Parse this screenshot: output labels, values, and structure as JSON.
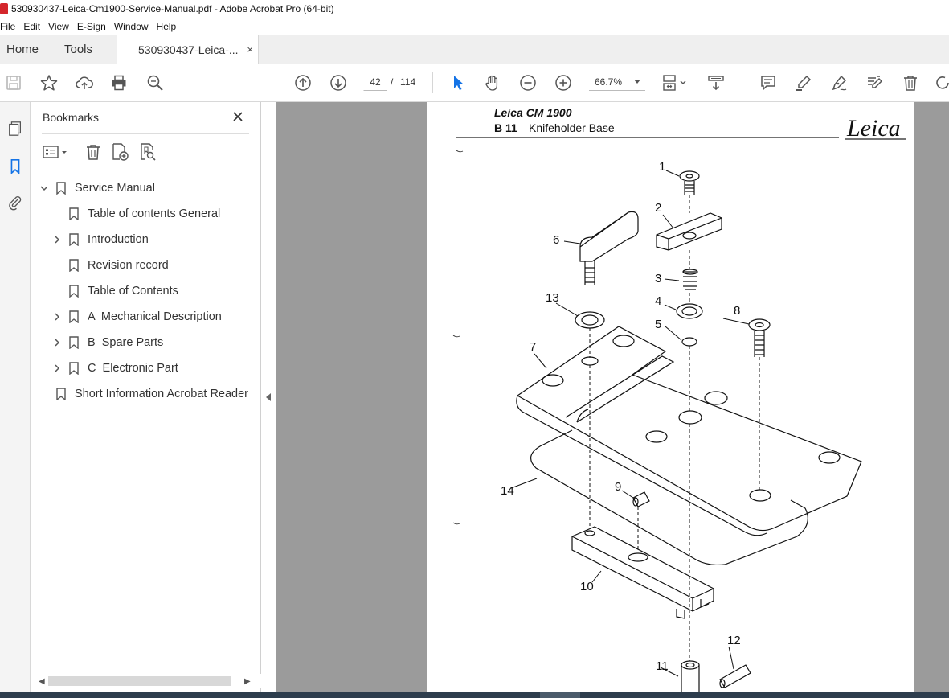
{
  "window": {
    "title": "530930437-Leica-Cm1900-Service-Manual.pdf - Adobe Acrobat Pro (64-bit)"
  },
  "menu": [
    "File",
    "Edit",
    "View",
    "E-Sign",
    "Window",
    "Help"
  ],
  "tabs": {
    "home": "Home",
    "tools": "Tools",
    "document": "530930437-Leica-...",
    "close": "×"
  },
  "toolbar": {
    "current_page": "42",
    "page_separator": "/",
    "total_pages": "114",
    "zoom": "66.7%"
  },
  "bookmarks": {
    "title": "Bookmarks",
    "items": [
      {
        "label": "Service Manual",
        "level": 0,
        "expandable": true,
        "expanded": true
      },
      {
        "label": "Table of contents General",
        "level": 1,
        "expandable": false
      },
      {
        "label": "Introduction",
        "level": 1,
        "expandable": true,
        "expanded": false
      },
      {
        "label": "Revision record",
        "level": 1,
        "expandable": false
      },
      {
        "label": "Table of Contents",
        "level": 1,
        "expandable": false
      },
      {
        "label": "A  Mechanical Description",
        "level": 1,
        "expandable": true,
        "expanded": false
      },
      {
        "label": "B  Spare Parts",
        "level": 1,
        "expandable": true,
        "expanded": false
      },
      {
        "label": "C  Electronic Part",
        "level": 1,
        "expandable": true,
        "expanded": false
      },
      {
        "label": "Short Information Acrobat Reader",
        "level": 0,
        "expandable": false
      }
    ]
  },
  "pdf_page": {
    "header_product": "Leica CM 1900",
    "section_code": "B 11",
    "section_title": "Knifeholder Base",
    "logo": "Leica",
    "callouts": [
      "1",
      "2",
      "3",
      "4",
      "5",
      "6",
      "7",
      "8",
      "9",
      "10",
      "11",
      "12",
      "13",
      "14"
    ]
  },
  "colors": {
    "accent_blue": "#1473e6",
    "viewport_gray": "#9b9b9b",
    "acrobat_red": "#d4262c"
  }
}
